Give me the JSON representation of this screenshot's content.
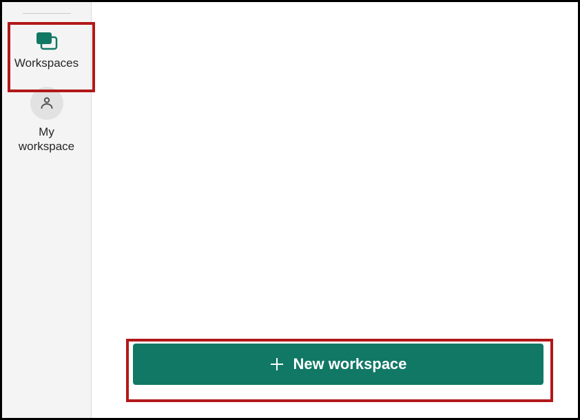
{
  "colors": {
    "accent": "#117865",
    "highlight": "#b21818",
    "sidebar_bg": "#f4f4f4",
    "text": "#262626"
  },
  "sidebar": {
    "items": [
      {
        "label": "Workspaces",
        "icon": "workspaces-icon"
      },
      {
        "label": "My\nworkspace",
        "icon": "person-icon"
      }
    ]
  },
  "main": {
    "new_workspace_label": "New workspace"
  }
}
